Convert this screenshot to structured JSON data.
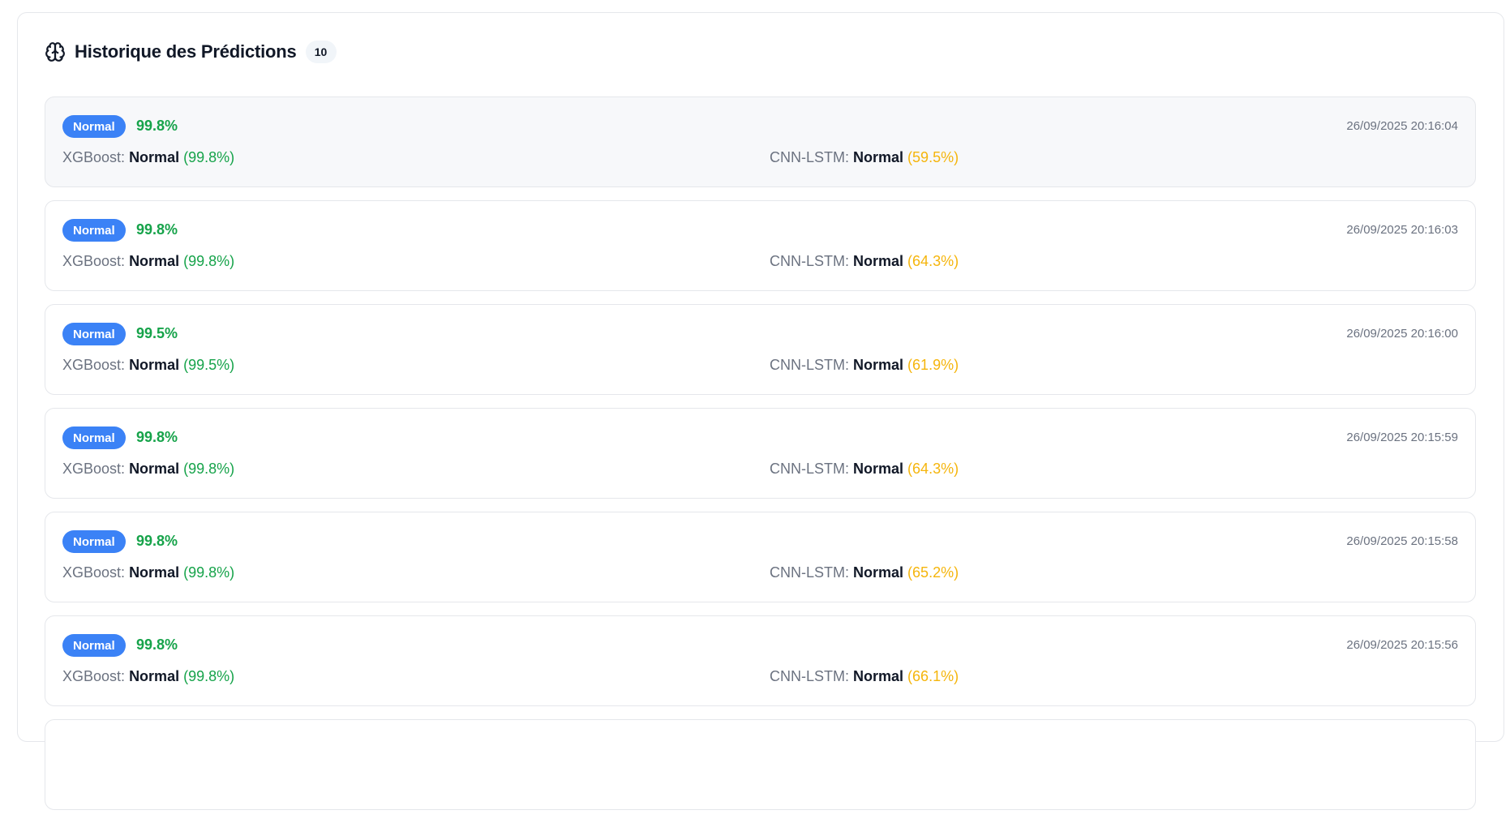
{
  "header": {
    "icon": "brain-icon",
    "title": "Historique des Prédictions",
    "count": "10"
  },
  "colors": {
    "badge_bg": "#3b82f6",
    "high_confidence": "#16a34a",
    "medium_confidence": "#f5b50c"
  },
  "predictions": [
    {
      "label": "Normal",
      "confidence": "99.8%",
      "timestamp": "26/09/2025 20:16:04",
      "xgb_name": "XGBoost:",
      "xgb_pred": "Normal",
      "xgb_conf": "(99.8%)",
      "cnn_name": "CNN-LSTM:",
      "cnn_pred": "Normal",
      "cnn_conf": "(59.5%)"
    },
    {
      "label": "Normal",
      "confidence": "99.8%",
      "timestamp": "26/09/2025 20:16:03",
      "xgb_name": "XGBoost:",
      "xgb_pred": "Normal",
      "xgb_conf": "(99.8%)",
      "cnn_name": "CNN-LSTM:",
      "cnn_pred": "Normal",
      "cnn_conf": "(64.3%)"
    },
    {
      "label": "Normal",
      "confidence": "99.5%",
      "timestamp": "26/09/2025 20:16:00",
      "xgb_name": "XGBoost:",
      "xgb_pred": "Normal",
      "xgb_conf": "(99.5%)",
      "cnn_name": "CNN-LSTM:",
      "cnn_pred": "Normal",
      "cnn_conf": "(61.9%)"
    },
    {
      "label": "Normal",
      "confidence": "99.8%",
      "timestamp": "26/09/2025 20:15:59",
      "xgb_name": "XGBoost:",
      "xgb_pred": "Normal",
      "xgb_conf": "(99.8%)",
      "cnn_name": "CNN-LSTM:",
      "cnn_pred": "Normal",
      "cnn_conf": "(64.3%)"
    },
    {
      "label": "Normal",
      "confidence": "99.8%",
      "timestamp": "26/09/2025 20:15:58",
      "xgb_name": "XGBoost:",
      "xgb_pred": "Normal",
      "xgb_conf": "(99.8%)",
      "cnn_name": "CNN-LSTM:",
      "cnn_pred": "Normal",
      "cnn_conf": "(65.2%)"
    },
    {
      "label": "Normal",
      "confidence": "99.8%",
      "timestamp": "26/09/2025 20:15:56",
      "xgb_name": "XGBoost:",
      "xgb_pred": "Normal",
      "xgb_conf": "(99.8%)",
      "cnn_name": "CNN-LSTM:",
      "cnn_pred": "Normal",
      "cnn_conf": "(66.1%)"
    }
  ]
}
